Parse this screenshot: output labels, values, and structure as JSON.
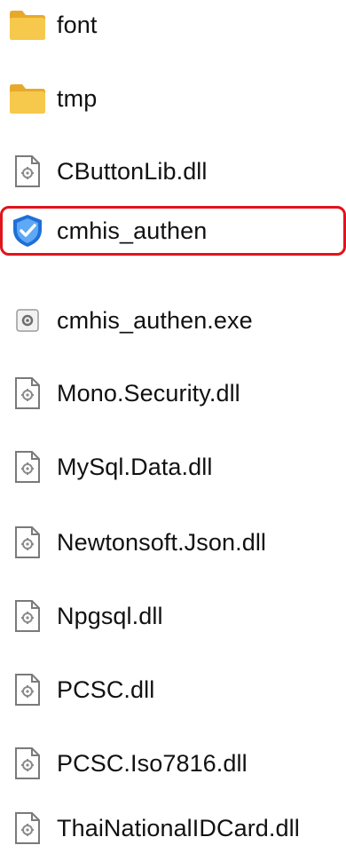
{
  "colors": {
    "highlight": "#e0141c",
    "folder": "#f4c24a",
    "text": "#111111",
    "shield": "#1e6fd9"
  },
  "files": [
    {
      "name": "font",
      "icon": "folder-icon"
    },
    {
      "name": "tmp",
      "icon": "folder-icon"
    },
    {
      "name": "CButtonLib.dll",
      "icon": "dll-file-icon"
    },
    {
      "name": "cmhis_authen",
      "icon": "shield-icon",
      "highlighted": true
    },
    {
      "name": "cmhis_authen.exe",
      "icon": "config-file-icon"
    },
    {
      "name": "Mono.Security.dll",
      "icon": "dll-file-icon"
    },
    {
      "name": "MySql.Data.dll",
      "icon": "dll-file-icon"
    },
    {
      "name": "Newtonsoft.Json.dll",
      "icon": "dll-file-icon"
    },
    {
      "name": "Npgsql.dll",
      "icon": "dll-file-icon"
    },
    {
      "name": "PCSC.dll",
      "icon": "dll-file-icon"
    },
    {
      "name": "PCSC.Iso7816.dll",
      "icon": "dll-file-icon"
    },
    {
      "name": "ThaiNationalIDCard.dll",
      "icon": "dll-file-icon"
    }
  ]
}
